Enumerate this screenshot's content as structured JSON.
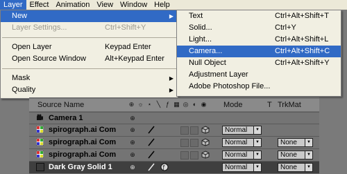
{
  "menubar": {
    "items": [
      {
        "label": "Layer",
        "active": true
      },
      {
        "label": "Effect"
      },
      {
        "label": "Animation"
      },
      {
        "label": "View"
      },
      {
        "label": "Window"
      },
      {
        "label": "Help"
      }
    ]
  },
  "layer_menu": {
    "new": "New",
    "layer_settings": "Layer Settings...",
    "layer_settings_sc": "Ctrl+Shift+Y",
    "open_layer": "Open Layer",
    "open_layer_sc": "Keypad Enter",
    "open_source": "Open Source Window",
    "open_source_sc": "Alt+Keypad Enter",
    "mask": "Mask",
    "quality": "Quality"
  },
  "new_submenu": {
    "text": "Text",
    "text_sc": "Ctrl+Alt+Shift+T",
    "solid": "Solid...",
    "solid_sc": "Ctrl+Y",
    "light": "Light...",
    "light_sc": "Ctrl+Alt+Shift+L",
    "camera": "Camera...",
    "camera_sc": "Ctrl+Alt+Shift+C",
    "null": "Null Object",
    "null_sc": "Ctrl+Alt+Shift+Y",
    "adjustment": "Adjustment Layer",
    "photoshop": "Adobe Photoshop File..."
  },
  "timeline": {
    "header": {
      "source_name": "Source Name",
      "mode": "Mode",
      "t": "T",
      "trkmat": "TrkMat"
    },
    "rows": [
      {
        "name": "Camera 1"
      },
      {
        "name": "spirograph.ai Com",
        "mode": "Normal"
      },
      {
        "name": "spirograph.ai Com",
        "mode": "Normal",
        "trkmat": "None"
      },
      {
        "name": "spirograph.ai Com",
        "mode": "Normal",
        "trkmat": "None"
      },
      {
        "name": "Dark Gray Solid 1",
        "mode": "Normal",
        "trkmat": "None"
      }
    ]
  },
  "colors": {
    "highlight": "#316ac5",
    "menu_bg": "#f1efe2",
    "panel_bg": "#6f6f6f"
  }
}
